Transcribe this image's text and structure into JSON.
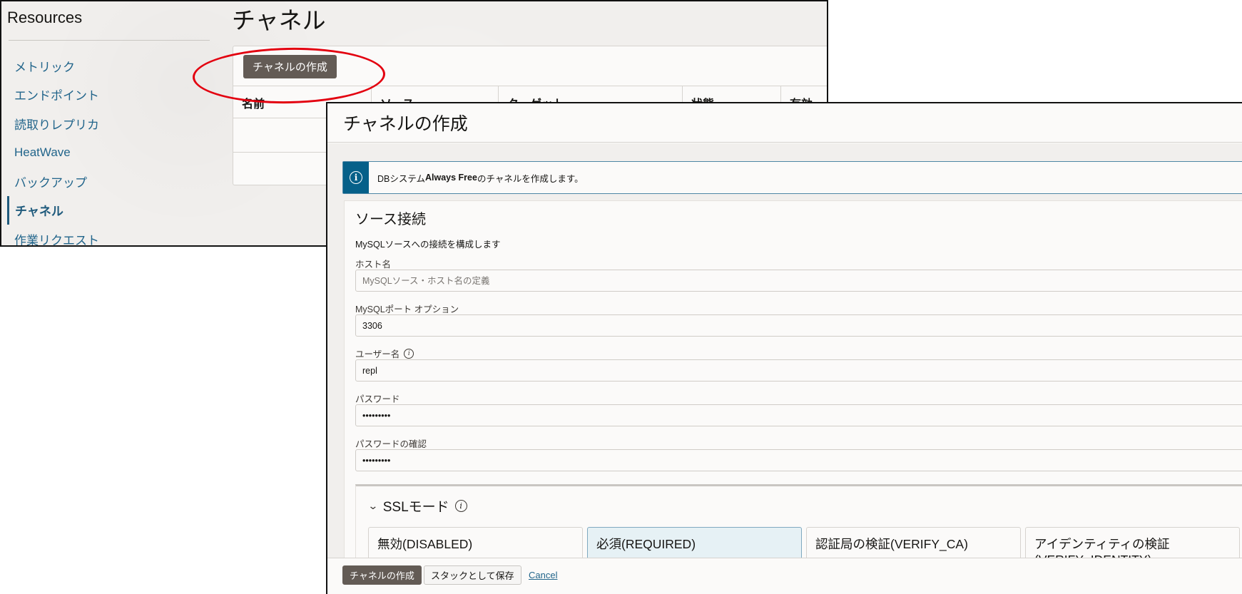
{
  "back_window": {
    "resources_title": "Resources",
    "sidebar": {
      "items": [
        {
          "label": "メトリック",
          "active": false
        },
        {
          "label": "エンドポイント",
          "active": false
        },
        {
          "label": "読取りレプリカ",
          "active": false
        },
        {
          "label": "HeatWave",
          "active": false
        },
        {
          "label": "バックアップ",
          "active": false
        },
        {
          "label": "チャネル",
          "active": true
        },
        {
          "label": "作業リクエスト",
          "active": false
        }
      ]
    },
    "page_title": "チャネル",
    "create_button": "チャネルの作成",
    "table": {
      "columns": [
        "名前",
        "ソース",
        "ターゲット",
        "状態",
        "有効"
      ]
    },
    "annotation_color": "#e3000f"
  },
  "dialog": {
    "title": "チャネルの作成",
    "info_banner": {
      "icon": "info-icon",
      "prefix": "DBシステム",
      "bold": "Always Free",
      "suffix": "のチャネルを作成します。"
    },
    "section": {
      "title": "ソース接続",
      "description": "MySQLソースへの接続を構成します",
      "fields": {
        "hostname": {
          "label": "ホスト名",
          "value": "",
          "placeholder": "MySQLソース・ホスト名の定義"
        },
        "port": {
          "label": "MySQLポート オプション",
          "value": "3306"
        },
        "username": {
          "label": "ユーザー名",
          "value": "repl",
          "has_info_icon": true
        },
        "password": {
          "label": "パスワード",
          "value": "•••••••••"
        },
        "password_confirm": {
          "label": "パスワードの確認",
          "value": "•••••••••"
        }
      }
    },
    "ssl_mode": {
      "title": "SSLモード",
      "expanded": true,
      "options": [
        {
          "label": "無効(DISABLED)",
          "selected": false
        },
        {
          "label": "必須(REQUIRED)",
          "selected": true
        },
        {
          "label": "認証局の検証(VERIFY_CA)",
          "selected": false
        },
        {
          "label": "アイデンティティの検証(VERIFY_IDENTITY)",
          "selected": false
        }
      ]
    },
    "footer": {
      "create_button": "チャネルの作成",
      "save_stack_button": "スタックとして保存",
      "cancel_link": "Cancel"
    }
  },
  "colors": {
    "accent": "#066089",
    "link": "#22658b",
    "primary_button": "#635b55",
    "selected_option_bg": "#e6f1f5"
  }
}
